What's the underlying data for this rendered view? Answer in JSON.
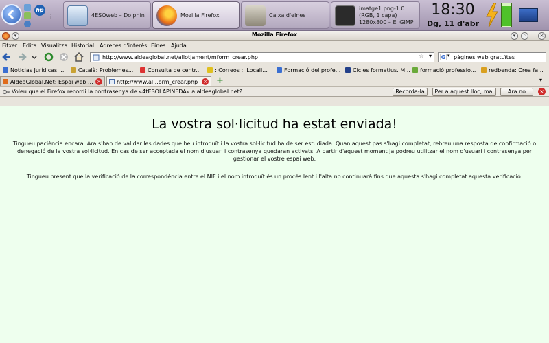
{
  "taskbar": {
    "tasks": [
      {
        "label": "4ESOweb – Dolphin",
        "icon": "dolphin-icon"
      },
      {
        "label": "Mozilla Firefox",
        "icon": "firefox-icon"
      },
      {
        "label": "Caixa d'eines",
        "icon": "gimp-icon"
      },
      {
        "label": "imatge1.png-1.0 (RGB, 1 capa) 1280x800 – El GIMP",
        "icon": "gimp-image-icon"
      }
    ],
    "clock": {
      "time": "18:30",
      "date": "Dg, 11 d'abr"
    },
    "battery_level": 0.85
  },
  "window": {
    "title": "Mozilla Firefox",
    "menu": [
      "Fitxer",
      "Edita",
      "Visualitza",
      "Historial",
      "Adreces d'interès",
      "Eines",
      "Ajuda"
    ],
    "url": "http://www.aldeaglobal.net/allotjament/mform_crear.php",
    "search": "pàgines web gratuïtes",
    "bookmarks": [
      {
        "label": "Noticias Jurídicas. ...",
        "color": "#3b6fd1"
      },
      {
        "label": "Català: Problemes...",
        "color": "#c9a233"
      },
      {
        "label": "Consulta de centr...",
        "color": "#d33"
      },
      {
        "label": ": Correos :. Locali...",
        "color": "#e0c020"
      },
      {
        "label": "Formació del profe...",
        "color": "#3b6fd1"
      },
      {
        "label": "Cicles formatius. M...",
        "color": "#23408a"
      },
      {
        "label": "formació professio...",
        "color": "#6aaa3a"
      },
      {
        "label": "redbenda: Crea fa...",
        "color": "#d9a020"
      }
    ],
    "tabs": [
      {
        "label": "AldeaGlobal.Net: Espai web ..."
      },
      {
        "label": "http://www.al...orm_crear.php"
      }
    ],
    "notification": {
      "message": "Voleu que el Firefox recordi la contrasenya de «4tESOLAPINEDA» a aldeaglobal.net?",
      "buttons": [
        "Recorda-la",
        "Per a aquest lloc, mai",
        "Ara no"
      ]
    }
  },
  "page": {
    "heading": "La vostra sol·licitud ha estat enviada!",
    "para1": "Tingueu paciència encara. Ara s'han de validar les dades que heu introduït i la vostra sol·licitud ha de ser estudiada. Quan aquest pas s'hagi completat, rebreu una resposta de confirmació o denegació de la vostra sol·licitud. En cas de ser acceptada el nom d'usuari i contrasenya quedaran activats. A partir d'aquest moment ja podreu utilitzar el nom d'usuari i contrasenya per gestionar el vostre espai web.",
    "para2": "Tingueu present que la verificació de la correspondència entre el NIF i el nom introduït és un procés lent i l'alta no continuarà fins que aquesta s'hagi completat aquesta verificació."
  }
}
